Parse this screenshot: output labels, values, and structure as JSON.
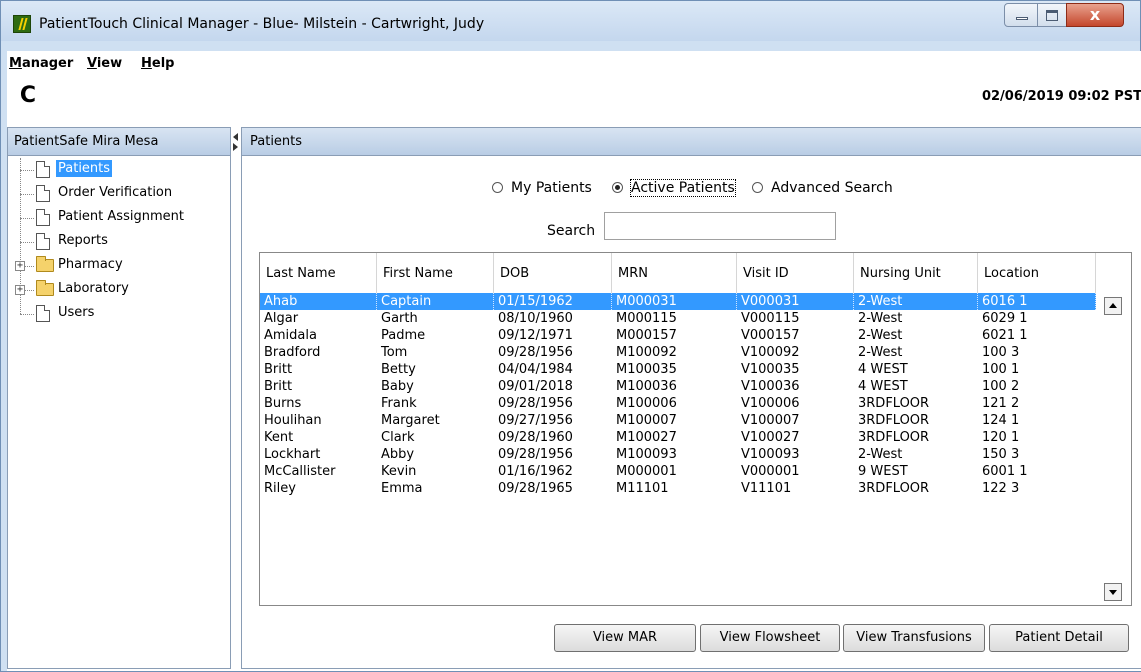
{
  "window": {
    "title": "PatientTouch Clinical Manager - Blue- Milstein - Cartwright, Judy",
    "close_glyph": "x"
  },
  "menu": {
    "manager": {
      "first": "M",
      "rest": "anager"
    },
    "view": {
      "first": "V",
      "rest": "iew"
    },
    "help": {
      "first": "H",
      "rest": "elp"
    }
  },
  "toolbar": {
    "refresh_glyph": "C",
    "datetime": "02/06/2019 09:02 PST"
  },
  "sidebar": {
    "header": "PatientSafe Mira Mesa",
    "items": [
      {
        "label": "Patients",
        "icon": "doc-icon",
        "selected": true,
        "expandable": false
      },
      {
        "label": "Order Verification",
        "icon": "doc-icon",
        "selected": false,
        "expandable": false
      },
      {
        "label": "Patient Assignment",
        "icon": "doc-icon",
        "selected": false,
        "expandable": false
      },
      {
        "label": "Reports",
        "icon": "doc-icon",
        "selected": false,
        "expandable": false
      },
      {
        "label": "Pharmacy",
        "icon": "folder-icon",
        "selected": false,
        "expandable": true
      },
      {
        "label": "Laboratory",
        "icon": "folder-icon",
        "selected": false,
        "expandable": true
      },
      {
        "label": "Users",
        "icon": "doc-icon",
        "selected": false,
        "expandable": false
      }
    ],
    "expand_glyph": "+"
  },
  "patients_panel": {
    "header": "Patients",
    "radios": {
      "my_patients": "My Patients",
      "active_patients": "Active Patients",
      "advanced_search": "Advanced Search",
      "selected": "active_patients"
    },
    "search": {
      "label": "Search",
      "value": ""
    },
    "table": {
      "columns": [
        "Last Name",
        "First Name",
        "DOB",
        "MRN",
        "Visit ID",
        "Nursing Unit",
        "Location"
      ],
      "rows": [
        [
          "Ahab",
          "Captain",
          "01/15/1962",
          "M000031",
          "V000031",
          "2-West",
          "6016 1"
        ],
        [
          "Algar",
          "Garth",
          "08/10/1960",
          "M000115",
          "V000115",
          "2-West",
          "6029 1"
        ],
        [
          "Amidala",
          "Padme",
          "09/12/1971",
          "M000157",
          "V000157",
          "2-West",
          "6021 1"
        ],
        [
          "Bradford",
          "Tom",
          "09/28/1956",
          "M100092",
          "V100092",
          "2-West",
          "100 3"
        ],
        [
          "Britt",
          "Betty",
          "04/04/1984",
          "M100035",
          "V100035",
          "4 WEST",
          "100 1"
        ],
        [
          "Britt",
          "Baby",
          "09/01/2018",
          "M100036",
          "V100036",
          "4 WEST",
          "100 2"
        ],
        [
          "Burns",
          "Frank",
          "09/28/1956",
          "M100006",
          "V100006",
          "3RDFLOOR",
          "121 2"
        ],
        [
          "Houlihan",
          "Margaret",
          "09/27/1956",
          "M100007",
          "V100007",
          "3RDFLOOR",
          "124 1"
        ],
        [
          "Kent",
          "Clark",
          "09/28/1960",
          "M100027",
          "V100027",
          "3RDFLOOR",
          "120 1"
        ],
        [
          "Lockhart",
          "Abby",
          "09/28/1956",
          "M100093",
          "V100093",
          "2-West",
          "150 3"
        ],
        [
          "McCallister",
          "Kevin",
          "01/16/1962",
          "M000001",
          "V000001",
          "9 WEST",
          "6001 1"
        ],
        [
          "Riley",
          "Emma",
          "09/28/1965",
          "M11101",
          "V11101",
          "3RDFLOOR",
          "122 3"
        ]
      ],
      "selected_row": 0
    },
    "buttons": {
      "view_mar": "View MAR",
      "view_flowsheet": "View Flowsheet",
      "view_transfusions": "View Transfusions",
      "patient_detail": "Patient Detail"
    }
  },
  "colors": {
    "selection": "#3399ff",
    "header_gradient_top": "#d8e4f2",
    "header_gradient_bottom": "#b9cde5",
    "window_frame": "#cfe0f2"
  }
}
